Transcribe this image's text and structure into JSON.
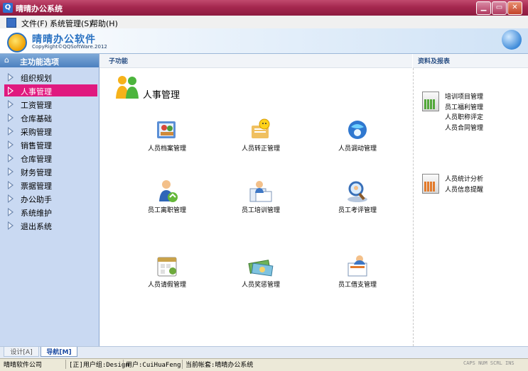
{
  "window": {
    "title": "晴晴办公系统"
  },
  "menu": [
    {
      "label": "文件(F)"
    },
    {
      "label": "系统管理(S)"
    },
    {
      "label": "帮助(H)"
    }
  ],
  "banner": {
    "brand": "晴晴办公软件",
    "copyright": "CopyRight©QQSoftWare.2012"
  },
  "sidebar": {
    "header": "主功能选项",
    "items": [
      {
        "label": "组织规划",
        "active": false
      },
      {
        "label": "人事管理",
        "active": true
      },
      {
        "label": "工资管理",
        "active": false
      },
      {
        "label": "仓库基础",
        "active": false
      },
      {
        "label": "采购管理",
        "active": false
      },
      {
        "label": "销售管理",
        "active": false
      },
      {
        "label": "仓库管理",
        "active": false
      },
      {
        "label": "财务管理",
        "active": false
      },
      {
        "label": "票据管理",
        "active": false
      },
      {
        "label": "办公助手",
        "active": false
      },
      {
        "label": "系统维护",
        "active": false
      },
      {
        "label": "退出系统",
        "active": false
      }
    ]
  },
  "main": {
    "header": "子功能",
    "section_title": "人事管理",
    "functions": [
      {
        "label": "人员档案管理",
        "icon": "people-folder-icon"
      },
      {
        "label": "人员转正管理",
        "icon": "smiley-notes-icon"
      },
      {
        "label": "人员调动管理",
        "icon": "globe-transfer-icon"
      },
      {
        "label": "员工离职管理",
        "icon": "person-recycle-icon"
      },
      {
        "label": "员工培训管理",
        "icon": "person-documents-icon"
      },
      {
        "label": "员工考评管理",
        "icon": "magnifier-person-icon"
      },
      {
        "label": "人员请假管理",
        "icon": "calendar-clip-icon"
      },
      {
        "label": "人员奖惩管理",
        "icon": "money-bills-icon"
      },
      {
        "label": "员工借支管理",
        "icon": "person-money-icon"
      }
    ]
  },
  "reports": {
    "header": "资料及报表",
    "groups": [
      {
        "icon": "green-chart-icon",
        "links": [
          "培训项目管理",
          "员工福利管理",
          "人员职称评定",
          "人员合同管理"
        ]
      },
      {
        "icon": "orange-chart-icon",
        "links": [
          "人员统计分析",
          "人员信息提醒"
        ]
      }
    ]
  },
  "tabs": [
    {
      "label": "设计[A]",
      "active": false
    },
    {
      "label": "导航[M]",
      "active": true
    }
  ],
  "status": {
    "company": "晴晴软件公司",
    "group": "[正]用户组:Design",
    "user": "用户:CuiHuaFeng",
    "account": "当前帐套:晴晴办公系统",
    "keys": "CAPS NUM SCRL INS"
  }
}
